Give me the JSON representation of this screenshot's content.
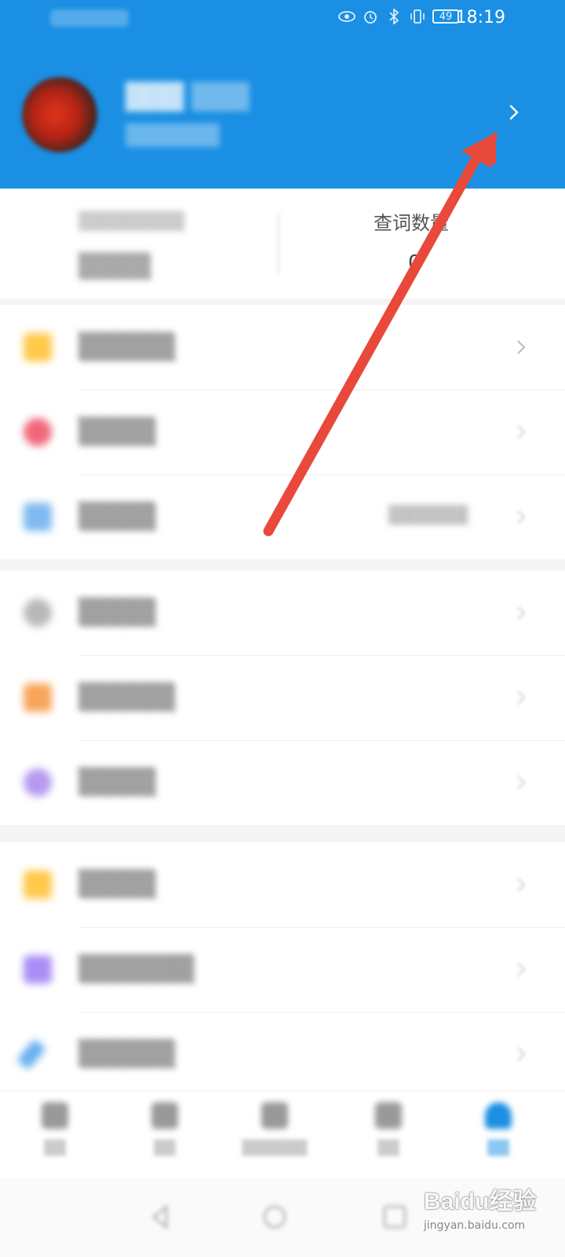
{
  "status_bar": {
    "time": "18:19",
    "battery": "49",
    "icons": [
      "eye-icon",
      "alarm-icon",
      "bluetooth-icon",
      "vibrate-icon"
    ]
  },
  "profile": {
    "chevron_icon": "chevron-right-icon"
  },
  "stats": {
    "right_label": "查词数量",
    "right_value": "0"
  },
  "menu_groups": [
    {
      "items": [
        {
          "icon": "folder-icon",
          "color": "#ffc94a",
          "has_extra": false
        },
        {
          "icon": "record-icon",
          "color": "#f0687a",
          "has_extra": false
        },
        {
          "icon": "book-icon",
          "color": "#7fbaf0",
          "has_extra": true
        }
      ]
    },
    {
      "items": [
        {
          "icon": "gear-icon",
          "color": "#b8b8b8"
        },
        {
          "icon": "palette-icon",
          "color": "#f7a55a"
        },
        {
          "icon": "speech-icon",
          "color": "#b59af0"
        }
      ]
    },
    {
      "items": [
        {
          "icon": "file-icon",
          "color": "#ffc94a"
        },
        {
          "icon": "pdf-icon",
          "color": "#a98ef5"
        },
        {
          "icon": "pen-icon",
          "color": "#6ab0f0"
        }
      ]
    }
  ],
  "tab_bar": {
    "active_index": 4,
    "accent": "#1a8fe3"
  },
  "colors": {
    "header": "#1a8fe3",
    "annotation_arrow": "#e8493a"
  },
  "watermark": {
    "brand": "Baidu经验",
    "url": "jingyan.baidu.com"
  }
}
